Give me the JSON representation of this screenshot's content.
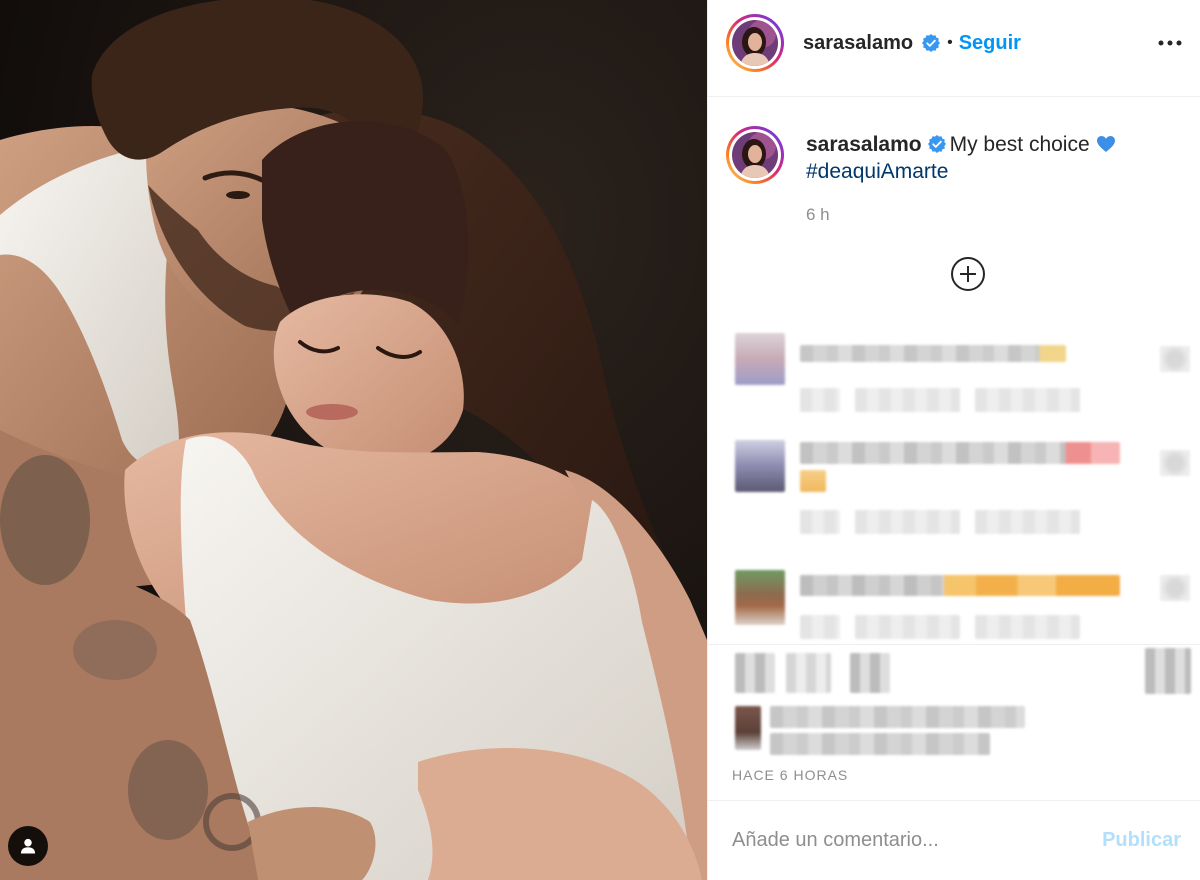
{
  "header": {
    "username": "sarasalamo",
    "verified_icon": "verified-badge-icon",
    "separator": "•",
    "follow_label": "Seguir",
    "more_icon": "more-options-icon"
  },
  "caption": {
    "username": "sarasalamo",
    "verified_icon": "verified-badge-icon",
    "text": "My best choice",
    "emoji_icon": "blue-heart-emoji-icon",
    "hashtag": "#deaquiAmarte",
    "time": "6 h"
  },
  "comments": {
    "load_more_icon": "plus-circle-icon"
  },
  "post_meta": {
    "timestamp": "HACE 6 HORAS"
  },
  "comment_box": {
    "placeholder": "Añade un comentario...",
    "submit_label": "Publicar"
  },
  "photo": {
    "tag_icon": "user-tag-icon"
  },
  "colors": {
    "text": "#262626",
    "accent": "#0095f6",
    "link": "#00376b",
    "muted": "#8e8e8e",
    "submit_disabled": "#b2dffc",
    "verified": "#3897f0",
    "divider": "#efefef",
    "heart_emoji": "#3d8ee6"
  }
}
